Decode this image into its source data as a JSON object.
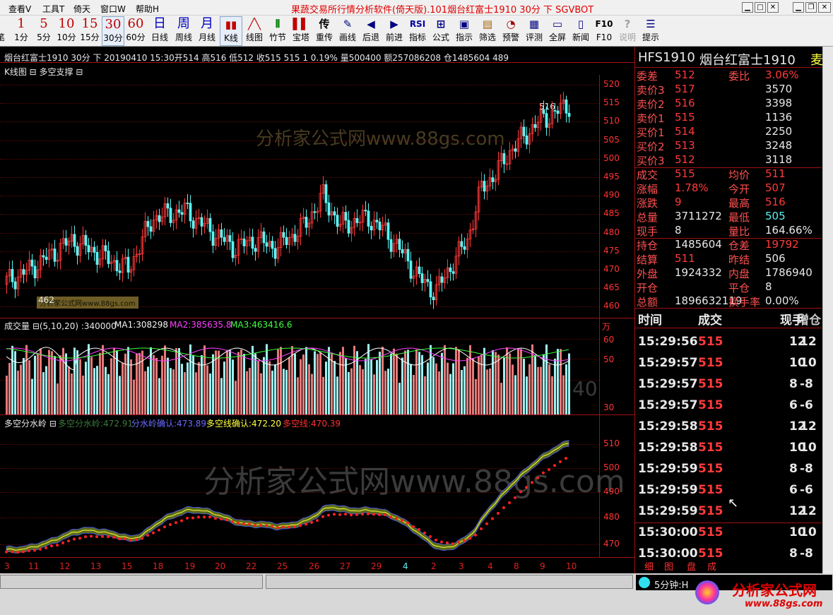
{
  "menu": {
    "items": [
      "查看V",
      "工具T",
      "倚天",
      "窗口W",
      "帮助H"
    ],
    "app_title": "果蔬交易所行情分析软件(倚天版).101烟台红富士1910 30分 下 SGVBOT"
  },
  "toolbar": {
    "periods": [
      {
        "big": "1",
        "label": "1分"
      },
      {
        "big": "5",
        "label": "5分"
      },
      {
        "big": "10",
        "label": "10分"
      },
      {
        "big": "15",
        "label": "15分"
      },
      {
        "big": "30",
        "label": "30分"
      },
      {
        "big": "60",
        "label": "60分"
      },
      {
        "big": "日",
        "label": "日线"
      },
      {
        "big": "周",
        "label": "周线"
      },
      {
        "big": "月",
        "label": "月线"
      }
    ],
    "left_cut_label": "笔",
    "tools": [
      "K线",
      "线图",
      "竹节",
      "宝塔",
      "重传",
      "画线",
      "后退",
      "前进",
      "指标",
      "公式",
      "指示",
      "筛选",
      "预警",
      "评测",
      "全屏",
      "新闻",
      "F10",
      "说明",
      "提示"
    ]
  },
  "header": {
    "info": "烟台红富士1910 30分 下 20190410 15:30开514 高516 低512 收515 515  1 0.19% 量500400 额257086208 仓1485604 489",
    "kline_title": "K线图 ⊟ 多空支撑 ⊟",
    "price_high_mark": "516",
    "price_low_mark": "462"
  },
  "price_axis": [
    "520",
    "515",
    "510",
    "505",
    "500",
    "495",
    "490",
    "485",
    "480",
    "475",
    "470",
    "465",
    "460"
  ],
  "volume": {
    "title": "成交量 ⊟(5,10,20) :340000",
    "ma1": "MA1:308298",
    "ma2": "MA2:385635.8",
    "ma3": "MA3:463416.6",
    "unit": "万",
    "axis": [
      "60",
      "50",
      "40",
      "30"
    ]
  },
  "indicator": {
    "title": "多空分水岭 ⊟",
    "l1": "多空分水岭:472.91",
    "l2": "分水岭确认:473.89",
    "l3": "多空线确认:472.20",
    "l4": "多空线:470.39",
    "axis": [
      "510",
      "500",
      "490",
      "480",
      "470"
    ]
  },
  "x_axis": [
    "3",
    "11",
    "12",
    "13",
    "15",
    "18",
    "19",
    "20",
    "22",
    "25",
    "26",
    "27",
    "29",
    "4",
    "2",
    "3",
    "4",
    "8",
    "9",
    "10"
  ],
  "watermarks": {
    "site": "分析家公式网www.88gs.com",
    "small": "分析家公式网www.88gs.com"
  },
  "quote": {
    "code": "HFS1910",
    "name": "烟台红富士1910",
    "name_tail": "麦",
    "rows": [
      {
        "l1": "委差",
        "v1": "512",
        "c1": "red",
        "l2": "委比",
        "v2": "3.06%",
        "c2": "red"
      },
      {
        "l1": "卖价3",
        "v1": "517",
        "c1": "red",
        "l2": "",
        "v2": "3570",
        "c2": "white"
      },
      {
        "l1": "卖价2",
        "v1": "516",
        "c1": "red",
        "l2": "",
        "v2": "3398",
        "c2": "white"
      },
      {
        "l1": "卖价1",
        "v1": "515",
        "c1": "red",
        "l2": "",
        "v2": "1136",
        "c2": "white"
      },
      {
        "l1": "买价1",
        "v1": "514",
        "c1": "red",
        "l2": "",
        "v2": "2250",
        "c2": "white"
      },
      {
        "l1": "买价2",
        "v1": "513",
        "c1": "red",
        "l2": "",
        "v2": "3248",
        "c2": "white"
      },
      {
        "l1": "买价3",
        "v1": "512",
        "c1": "red",
        "l2": "",
        "v2": "3118",
        "c2": "white"
      },
      {
        "l1": "成交",
        "v1": "515",
        "c1": "red",
        "l2": "均价",
        "v2": "511",
        "c2": "red"
      },
      {
        "l1": "涨幅",
        "v1": "1.78%",
        "c1": "red",
        "l2": "今开",
        "v2": "507",
        "c2": "red"
      },
      {
        "l1": "涨跌",
        "v1": "9",
        "c1": "red",
        "l2": "最高",
        "v2": "516",
        "c2": "red"
      },
      {
        "l1": "总量",
        "v1": "3711272",
        "c1": "white",
        "l2": "最低",
        "v2": "505",
        "c2": "cyan"
      },
      {
        "l1": "现手",
        "v1": "8",
        "c1": "white",
        "l2": "量比",
        "v2": "164.66%",
        "c2": "white"
      },
      {
        "l1": "持仓",
        "v1": "1485604",
        "c1": "white",
        "l2": "仓差",
        "v2": "19792",
        "c2": "red"
      },
      {
        "l1": "结算",
        "v1": "511",
        "c1": "red",
        "l2": "昨结",
        "v2": "506",
        "c2": "white"
      },
      {
        "l1": "外盘",
        "v1": "1924332",
        "c1": "white",
        "l2": "内盘",
        "v2": "1786940",
        "c2": "white"
      },
      {
        "l1": "开仓",
        "v1": "",
        "c1": "white",
        "l2": "平仓",
        "v2": "8",
        "c2": "white"
      },
      {
        "l1": "总额",
        "v1": "1896632119",
        "c1": "white",
        "l2": "换手率",
        "v2": "0.00%",
        "c2": "white"
      }
    ]
  },
  "ticks": {
    "headers": [
      "时间",
      "成交",
      "现手",
      "增仓"
    ],
    "rows": [
      {
        "time": "15:29:56",
        "price": "515",
        "vol": "12",
        "oi": "12"
      },
      {
        "time": "15:29:57",
        "price": "515",
        "vol": "10",
        "oi": "10"
      },
      {
        "time": "15:29:57",
        "price": "515",
        "vol": "8",
        "oi": "-8"
      },
      {
        "time": "15:29:57",
        "price": "515",
        "vol": "6",
        "oi": "-6"
      },
      {
        "time": "15:29:58",
        "price": "515",
        "vol": "12",
        "oi": "12"
      },
      {
        "time": "15:29:58",
        "price": "515",
        "vol": "10",
        "oi": "10"
      },
      {
        "time": "15:29:59",
        "price": "515",
        "vol": "8",
        "oi": "-8"
      },
      {
        "time": "15:29:59",
        "price": "515",
        "vol": "6",
        "oi": "-6"
      },
      {
        "time": "15:29:59",
        "price": "515",
        "vol": "12",
        "oi": "12"
      },
      {
        "time": "15:30:00",
        "price": "515",
        "vol": "10",
        "oi": "10"
      },
      {
        "time": "15:30:00",
        "price": "515",
        "vol": "8",
        "oi": "-8"
      }
    ],
    "tabs": [
      "细",
      "图",
      "盘",
      "成"
    ]
  },
  "status": {
    "left": "",
    "right": "5分钟:H",
    "logo": "分析家公式网",
    "logo_url": "www.88gs.com"
  },
  "colors": {
    "up": "#ff3a3a",
    "down": "#5cf2f2",
    "background": "#000000"
  }
}
